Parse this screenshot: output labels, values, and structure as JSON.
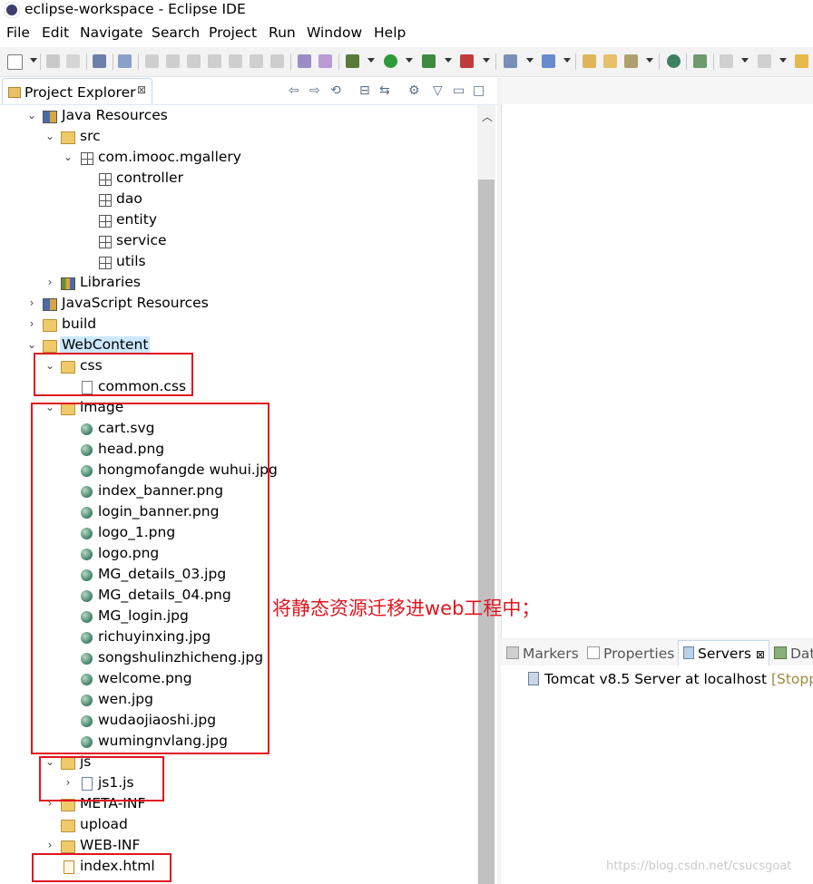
{
  "window": {
    "title": "eclipse-workspace - Eclipse IDE"
  },
  "menu": [
    "File",
    "Edit",
    "Navigate",
    "Search",
    "Project",
    "Run",
    "Window",
    "Help"
  ],
  "project_explorer": {
    "tab_label": "Project Explorer",
    "tab_close": "⊠",
    "tree": [
      {
        "label": "Java Resources",
        "icon": "java-resources-icon",
        "expanded": true
      },
      {
        "label": "src",
        "icon": "source-folder-icon",
        "expanded": true
      },
      {
        "label": "com.imooc.mgallery",
        "icon": "package-icon",
        "expanded": true
      },
      {
        "label": "controller",
        "icon": "package-icon"
      },
      {
        "label": "dao",
        "icon": "package-icon"
      },
      {
        "label": "entity",
        "icon": "package-icon"
      },
      {
        "label": "service",
        "icon": "package-icon"
      },
      {
        "label": "utils",
        "icon": "package-icon"
      },
      {
        "label": "Libraries",
        "icon": "libraries-icon",
        "expanded": false
      },
      {
        "label": "JavaScript Resources",
        "icon": "javascript-resources-icon",
        "expanded": false
      },
      {
        "label": "build",
        "icon": "folder-icon",
        "expanded": false
      },
      {
        "label": "WebContent",
        "icon": "folder-icon",
        "expanded": true,
        "selected": true
      },
      {
        "label": "css",
        "icon": "folder-icon",
        "expanded": true
      },
      {
        "label": "common.css",
        "icon": "css-file-icon"
      },
      {
        "label": "image",
        "icon": "folder-icon",
        "expanded": true
      },
      {
        "label": "cart.svg",
        "icon": "image-file-icon"
      },
      {
        "label": "head.png",
        "icon": "image-file-icon"
      },
      {
        "label": "hongmofangde wuhui.jpg",
        "icon": "image-file-icon"
      },
      {
        "label": "index_banner.png",
        "icon": "image-file-icon"
      },
      {
        "label": "login_banner.png",
        "icon": "image-file-icon"
      },
      {
        "label": "logo_1.png",
        "icon": "image-file-icon"
      },
      {
        "label": "logo.png",
        "icon": "image-file-icon"
      },
      {
        "label": "MG_details_03.jpg",
        "icon": "image-file-icon"
      },
      {
        "label": "MG_details_04.png",
        "icon": "image-file-icon"
      },
      {
        "label": "MG_login.jpg",
        "icon": "image-file-icon"
      },
      {
        "label": "richuyinxing.jpg",
        "icon": "image-file-icon"
      },
      {
        "label": "songshulinzhicheng.jpg",
        "icon": "image-file-icon"
      },
      {
        "label": "welcome.png",
        "icon": "image-file-icon"
      },
      {
        "label": "wen.jpg",
        "icon": "image-file-icon"
      },
      {
        "label": "wudaojiaoshi.jpg",
        "icon": "image-file-icon"
      },
      {
        "label": "wumingnvlang.jpg",
        "icon": "image-file-icon"
      },
      {
        "label": "js",
        "icon": "folder-icon",
        "expanded": true
      },
      {
        "label": "js1.js",
        "icon": "js-file-icon",
        "expanded": false
      },
      {
        "label": "META-INF",
        "icon": "folder-icon",
        "expanded": false
      },
      {
        "label": "upload",
        "icon": "folder-icon"
      },
      {
        "label": "WEB-INF",
        "icon": "folder-icon",
        "expanded": false
      },
      {
        "label": "index.html",
        "icon": "html-file-icon"
      }
    ]
  },
  "bottom_panel": {
    "tabs": [
      {
        "label": "Markers",
        "icon": "markers-icon"
      },
      {
        "label": "Properties",
        "icon": "properties-icon"
      },
      {
        "label": "Servers",
        "icon": "servers-icon",
        "active": true
      },
      {
        "label": "Dat",
        "icon": "data-source-icon"
      }
    ],
    "server": {
      "name": "Tomcat v8.5 Server at localhost",
      "status": "[Stoppe"
    }
  },
  "annotation": "将静态资源迁移进web工程中；",
  "watermark": "https://blog.csdn.net/csucsgoat",
  "colors": {
    "annotation_red": "#e0151f",
    "selection_bg": "#cde8ff"
  }
}
